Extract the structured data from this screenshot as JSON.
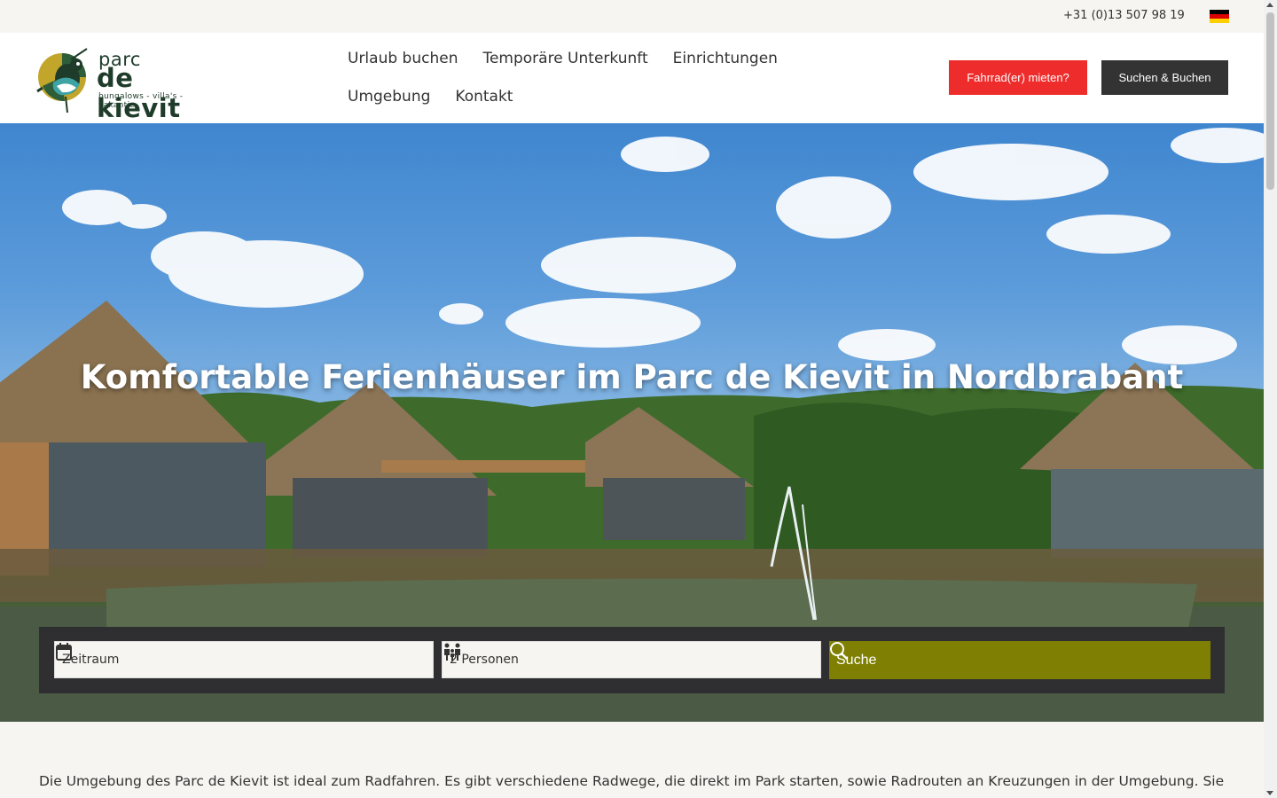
{
  "topbar": {
    "phone": "+31 (0)13 507 98 19",
    "language_flag": "german-flag"
  },
  "header": {
    "logo": {
      "line1": "parc",
      "line2": "de kievit",
      "tagline": "bungalows - villa's - vakantie"
    },
    "nav": [
      {
        "label": "Urlaub buchen"
      },
      {
        "label": "Temporäre Unterkunft"
      },
      {
        "label": "Einrichtungen"
      },
      {
        "label": "Umgebung"
      },
      {
        "label": "Kontakt"
      }
    ],
    "bike_button": "Fahrrad(er) mieten?",
    "book_button": "Suchen & Buchen"
  },
  "hero": {
    "title": "Komfortable Ferienhäuser im Parc de Kievit in Nordbrabant"
  },
  "search": {
    "date_field": "Zeitraum",
    "persons_field": "2 Personen",
    "search_button": "Suche"
  },
  "intro": {
    "text": "Die Umgebung des Parc de Kievit ist ideal zum Radfahren. Es gibt verschiedene Radwege, die direkt im Park starten, sowie Radrouten an Kreuzungen in der Umgebung. Sie können ganz"
  },
  "colors": {
    "bike_button": "#ef2c2c",
    "book_button": "#333333",
    "search_button": "#7f8003",
    "search_panel": "#2f2f31"
  }
}
